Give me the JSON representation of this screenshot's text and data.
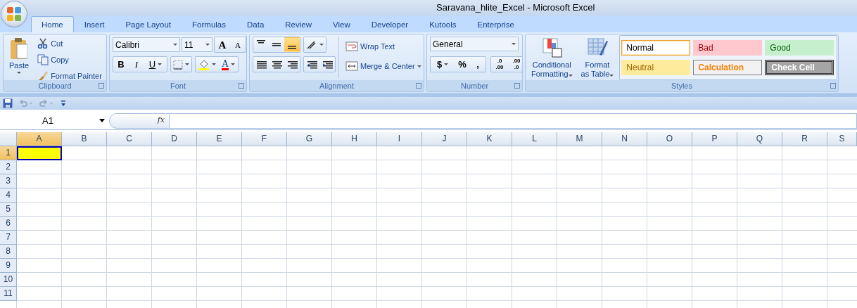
{
  "window": {
    "title": "Saravana_hlite_Excel - Microsoft Excel"
  },
  "ribbon_tabs": [
    {
      "label": "Home",
      "selected": true
    },
    {
      "label": "Insert",
      "selected": false
    },
    {
      "label": "Page Layout",
      "selected": false
    },
    {
      "label": "Formulas",
      "selected": false
    },
    {
      "label": "Data",
      "selected": false
    },
    {
      "label": "Review",
      "selected": false
    },
    {
      "label": "View",
      "selected": false
    },
    {
      "label": "Developer",
      "selected": false
    },
    {
      "label": "Kutools",
      "selected": false
    },
    {
      "label": "Enterprise",
      "selected": false
    }
  ],
  "clipboard": {
    "label": "Clipboard",
    "paste": "Paste",
    "cut": "Cut",
    "copy": "Copy",
    "format_painter": "Format Painter"
  },
  "font": {
    "label": "Font",
    "name": "Calibri",
    "size": "11",
    "grow": "A",
    "shrink": "A",
    "bold": "B",
    "italic": "I",
    "underline": "U",
    "font_color": "A"
  },
  "alignment": {
    "label": "Alignment",
    "vertical": [
      {
        "selected": false
      },
      {
        "selected": false
      },
      {
        "selected": true
      }
    ],
    "wrap_text": "Wrap Text",
    "merge": "Merge & Center"
  },
  "number": {
    "label": "Number",
    "format": "General",
    "currency": "$",
    "percent": "%",
    "comma": ",",
    "increase_decimal": [
      ".0",
      ".00"
    ],
    "decrease_decimal": [
      ".00",
      ".0"
    ]
  },
  "styles": {
    "label": "Styles",
    "conditional": [
      "Conditional",
      "Formatting"
    ],
    "format_table": [
      "Format",
      "as Table"
    ],
    "cells": [
      {
        "label": "Normal",
        "kind": "normal"
      },
      {
        "label": "Bad",
        "kind": "bad"
      },
      {
        "label": "Good",
        "kind": "good"
      },
      {
        "label": "Neutral",
        "kind": "neutral"
      },
      {
        "label": "Calculation",
        "kind": "calculation"
      },
      {
        "label": "Check Cell",
        "kind": "check"
      }
    ]
  },
  "formula_bar": {
    "name_box": "A1",
    "function_label": "fx"
  },
  "sheet": {
    "columns": [
      {
        "label": "A",
        "selected": true
      },
      {
        "label": "B",
        "selected": false
      },
      {
        "label": "C",
        "selected": false
      },
      {
        "label": "D",
        "selected": false
      },
      {
        "label": "E",
        "selected": false
      },
      {
        "label": "F",
        "selected": false
      },
      {
        "label": "G",
        "selected": false
      },
      {
        "label": "H",
        "selected": false
      },
      {
        "label": "I",
        "selected": false
      },
      {
        "label": "J",
        "selected": false
      },
      {
        "label": "K",
        "selected": false
      },
      {
        "label": "L",
        "selected": false
      },
      {
        "label": "M",
        "selected": false
      },
      {
        "label": "N",
        "selected": false
      },
      {
        "label": "O",
        "selected": false
      },
      {
        "label": "P",
        "selected": false
      },
      {
        "label": "Q",
        "selected": false
      },
      {
        "label": "R",
        "selected": false
      },
      {
        "label": "S",
        "selected": false
      }
    ],
    "rows": [
      {
        "label": "1",
        "selected": true
      },
      {
        "label": "2",
        "selected": false
      },
      {
        "label": "3",
        "selected": false
      },
      {
        "label": "4",
        "selected": false
      },
      {
        "label": "5",
        "selected": false
      },
      {
        "label": "6",
        "selected": false
      },
      {
        "label": "7",
        "selected": false
      },
      {
        "label": "8",
        "selected": false
      },
      {
        "label": "9",
        "selected": false
      },
      {
        "label": "10",
        "selected": false
      },
      {
        "label": "11",
        "selected": false
      }
    ]
  }
}
